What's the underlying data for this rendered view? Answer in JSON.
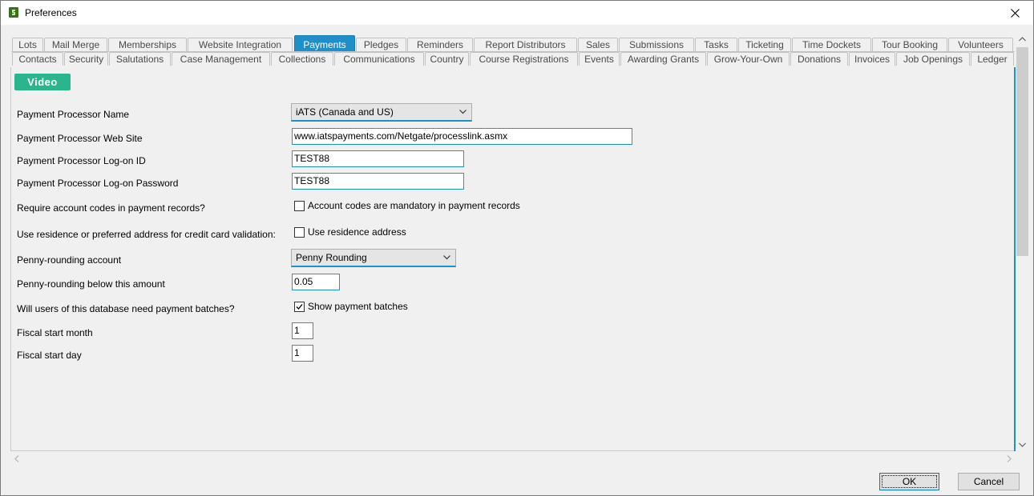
{
  "window": {
    "title": "Preferences"
  },
  "tabs_row1": [
    "Lots",
    "Mail Merge",
    "Memberships",
    "Website Integration",
    "Payments",
    "Pledges",
    "Reminders",
    "Report Distributors",
    "Sales",
    "Submissions",
    "Tasks",
    "Ticketing",
    "Time Dockets",
    "Tour Booking",
    "Volunteers"
  ],
  "tabs_row2": [
    "Contacts",
    "Security",
    "Salutations",
    "Case Management",
    "Collections",
    "Communications",
    "Country",
    "Course Registrations",
    "Events",
    "Awarding Grants",
    "Grow-Your-Own",
    "Donations",
    "Invoices",
    "Job Openings",
    "Ledger"
  ],
  "active_tab": "Payments",
  "video_button": "Video",
  "form": {
    "processor_name_label": "Payment Processor Name",
    "processor_name_value": "iATS (Canada and US)",
    "website_label": "Payment Processor Web Site",
    "website_value": "www.iatspayments.com/Netgate/processlink.asmx",
    "logon_id_label": "Payment Processor Log-on ID",
    "logon_id_value": "TEST88",
    "logon_pwd_label": "Payment Processor Log-on Password",
    "logon_pwd_value": "TEST88",
    "account_codes_label": "Require account codes in payment records?",
    "account_codes_check": "Account codes are mandatory in payment records",
    "account_codes_checked": false,
    "residence_label": "Use residence or preferred address for credit card validation:",
    "residence_check": "Use residence address",
    "residence_checked": false,
    "penny_account_label": "Penny-rounding account",
    "penny_account_value": "Penny Rounding",
    "penny_below_label": "Penny-rounding below this amount",
    "penny_below_value": "0.05",
    "batches_label": "Will users of this database need payment batches?",
    "batches_check": "Show payment batches",
    "batches_checked": true,
    "fiscal_month_label": "Fiscal start month",
    "fiscal_month_value": "1",
    "fiscal_day_label": "Fiscal start day",
    "fiscal_day_value": "1"
  },
  "buttons": {
    "ok": "OK",
    "cancel": "Cancel"
  },
  "colors": {
    "accent": "#1e8fc9",
    "video": "#2bb58f"
  }
}
